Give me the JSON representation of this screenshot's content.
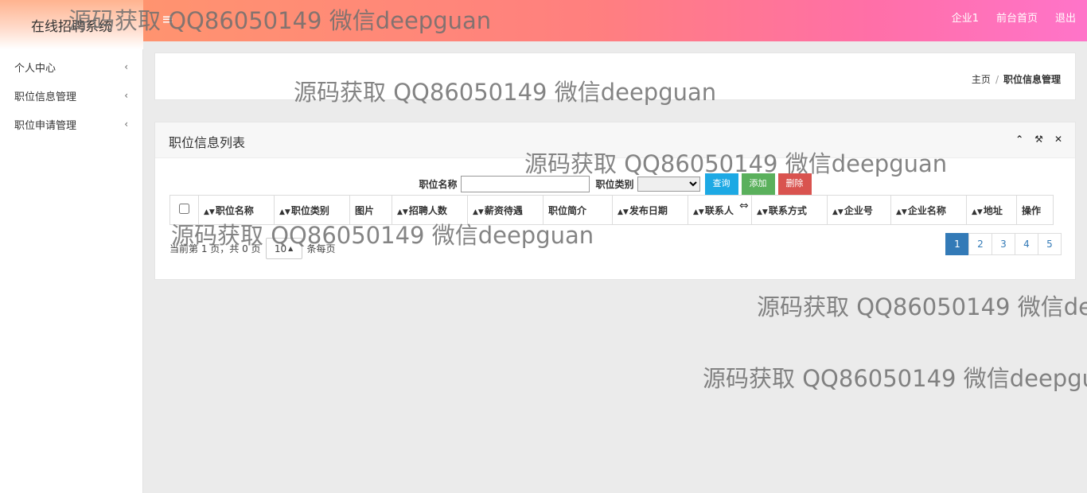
{
  "header": {
    "brand": "在线招聘系统",
    "menu_icon": "≡",
    "links": [
      "企业1",
      "前台首页",
      "退出"
    ]
  },
  "sidebar": {
    "items": [
      {
        "label": "个人中心",
        "chevron": "‹"
      },
      {
        "label": "职位信息管理",
        "chevron": "‹"
      },
      {
        "label": "职位申请管理",
        "chevron": "‹"
      }
    ]
  },
  "breadcrumb": {
    "home": "主页",
    "separator": "/",
    "current": "职位信息管理"
  },
  "panel": {
    "title": "职位信息列表",
    "tools": [
      "▲",
      "🔧",
      "✕"
    ]
  },
  "search": {
    "name_label": "职位名称",
    "name_value": "",
    "type_label": "职位类别",
    "type_value": "",
    "query_button": "查询",
    "add_button": "添加",
    "delete_button": "删除"
  },
  "table": {
    "columns": [
      {
        "label": "职位名称",
        "sortable": true
      },
      {
        "label": "职位类别",
        "sortable": true
      },
      {
        "label": "图片",
        "sortable": false
      },
      {
        "label": "招聘人数",
        "sortable": true
      },
      {
        "label": "薪资待遇",
        "sortable": true
      },
      {
        "label": "职位简介",
        "sortable": false
      },
      {
        "label": "发布日期",
        "sortable": true
      },
      {
        "label": "联系人",
        "sortable": true
      },
      {
        "label": "联系方式",
        "sortable": true
      },
      {
        "label": "企业号",
        "sortable": true
      },
      {
        "label": "企业名称",
        "sortable": true
      },
      {
        "label": "地址",
        "sortable": true
      },
      {
        "label": "操作",
        "sortable": false
      }
    ],
    "rows": []
  },
  "pager": {
    "info_prefix": "当前第 1 页，共 0 页",
    "page_size": "10",
    "info_suffix": "条每页",
    "pages": [
      "1",
      "2",
      "3",
      "4",
      "5"
    ],
    "current_page": "1"
  },
  "watermark": "源码获取 QQ86050149 微信deepguan",
  "colors": {
    "header_gradient_start": "#ff9a6a",
    "header_gradient_end": "#ff74c9",
    "query": "#1da9e4",
    "add": "#5ab05c",
    "delete": "#d9534f",
    "pager_active": "#337ab7"
  }
}
